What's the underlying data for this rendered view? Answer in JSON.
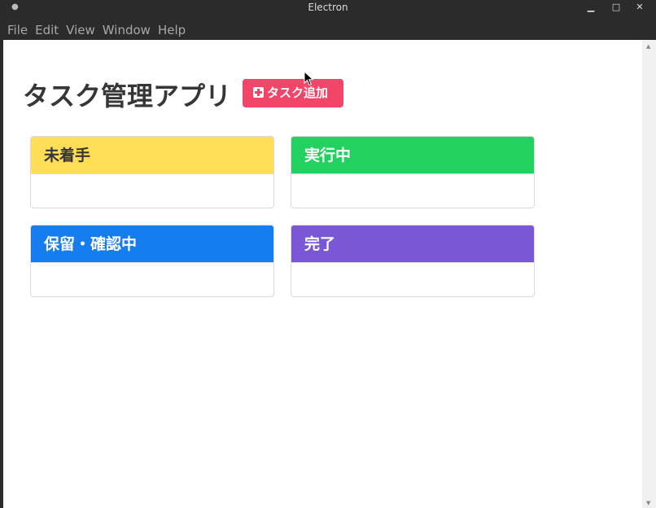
{
  "window": {
    "title": "Electron"
  },
  "menu": {
    "items": [
      "File",
      "Edit",
      "View",
      "Window",
      "Help"
    ]
  },
  "app": {
    "title": "タスク管理アプリ",
    "add_button_label": "タスク追加"
  },
  "columns": [
    {
      "label": "未着手",
      "color": "#ffdd57",
      "text_color": "#363636"
    },
    {
      "label": "実行中",
      "color": "#23d160",
      "text_color": "#ffffff"
    },
    {
      "label": "保留・確認中",
      "color": "#167df0",
      "text_color": "#ffffff"
    },
    {
      "label": "完了",
      "color": "#7957d5",
      "text_color": "#ffffff"
    }
  ],
  "icons": {
    "add": "plus-square-icon",
    "cursor": "mouse-pointer-icon"
  }
}
